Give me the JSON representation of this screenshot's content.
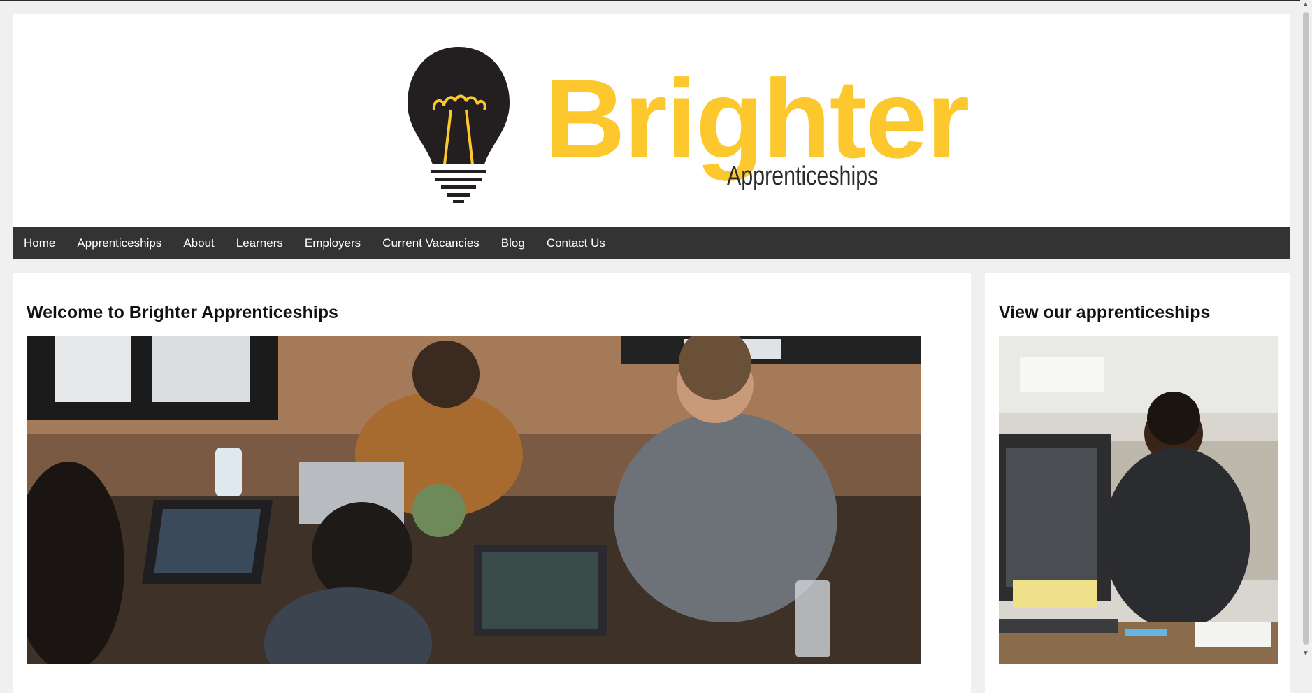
{
  "brand": {
    "name": "Brighter",
    "tagline": "Apprenticeships"
  },
  "nav": {
    "items": [
      "Home",
      "Apprenticeships",
      "About",
      "Learners",
      "Employers",
      "Current Vacancies",
      "Blog",
      "Contact Us"
    ]
  },
  "main": {
    "heading": "Welcome to Brighter Apprenticeships",
    "image_alt": "People working on laptops around a table"
  },
  "sidebar": {
    "heading": "View our apprenticeships",
    "image_alt": "Man writing at an office desk"
  },
  "colors": {
    "brand_yellow": "#fdc82e",
    "nav_bg": "#333333",
    "bulb_dark": "#231f20"
  }
}
